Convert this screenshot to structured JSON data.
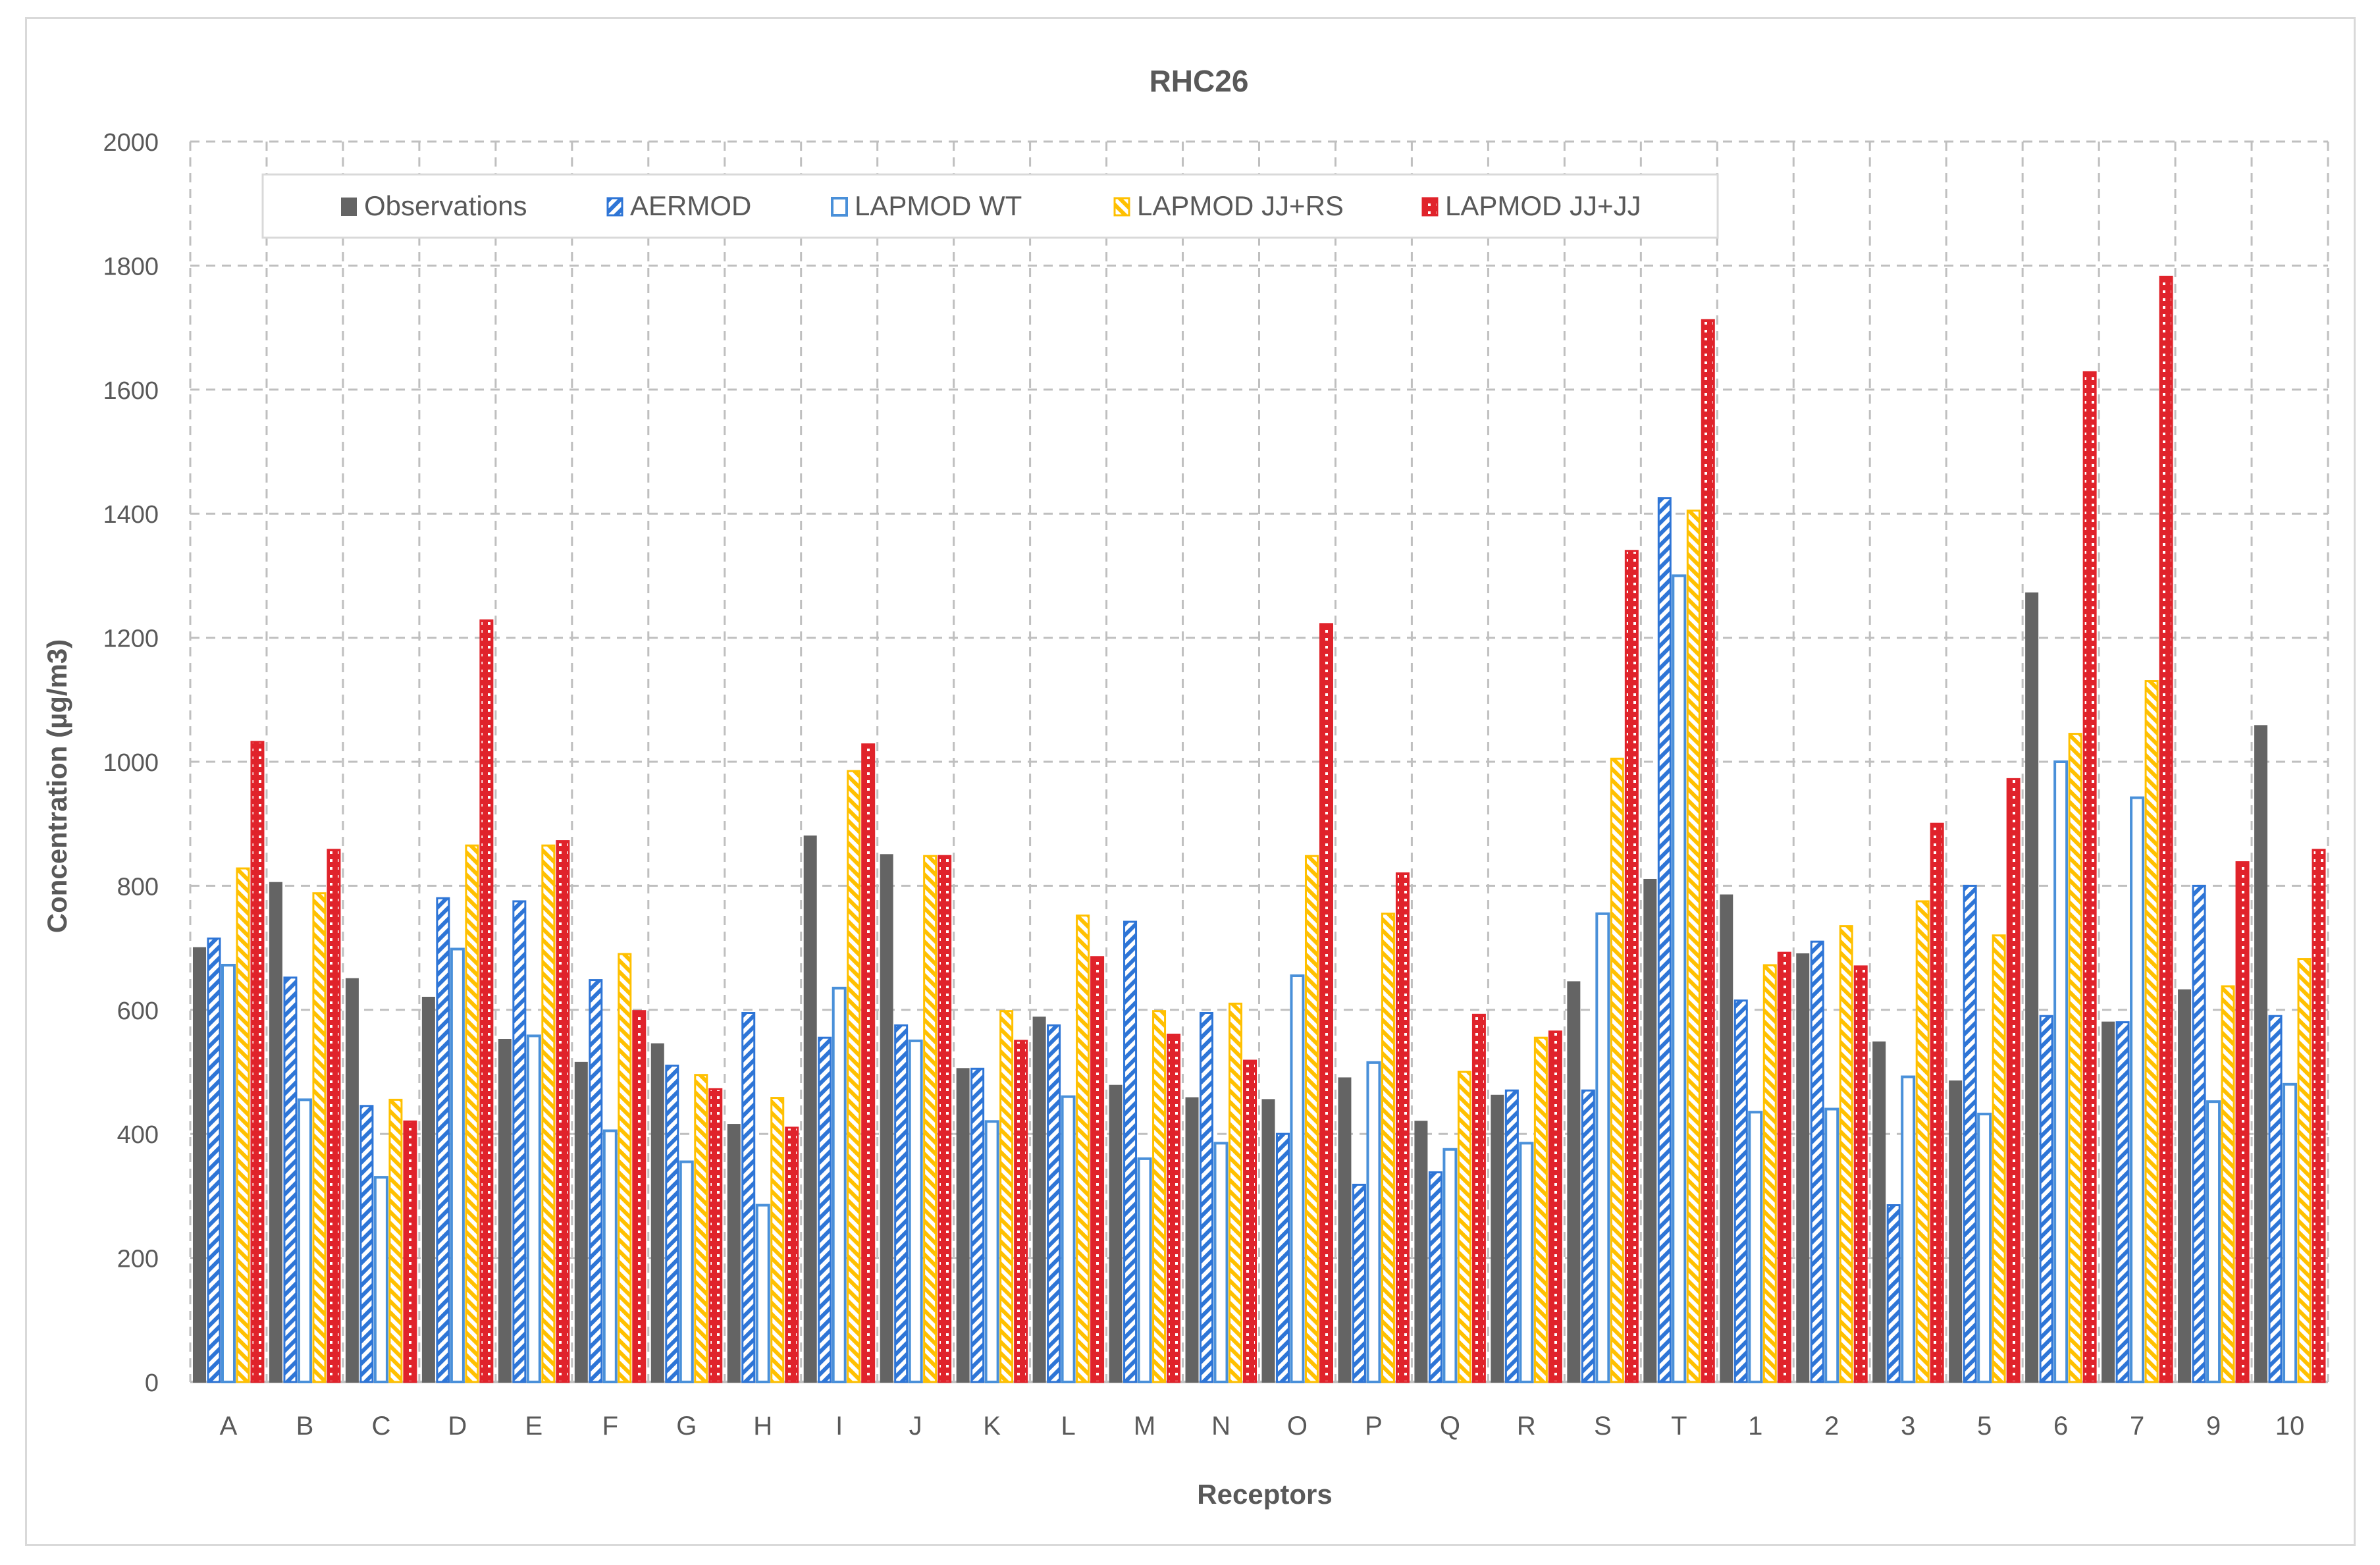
{
  "chart_data": {
    "type": "bar",
    "title": "RHC26",
    "xlabel": "Receptors",
    "ylabel": "Concentration (µg/m3)",
    "ylim": [
      0,
      2000
    ],
    "yticks": [
      0,
      200,
      400,
      600,
      800,
      1000,
      1200,
      1400,
      1600,
      1800,
      2000
    ],
    "grid": "dashed, both axes",
    "legend_position": "top-left, inside plot",
    "categories": [
      "A",
      "B",
      "C",
      "D",
      "E",
      "F",
      "G",
      "H",
      "I",
      "J",
      "K",
      "L",
      "M",
      "N",
      "O",
      "P",
      "Q",
      "R",
      "S",
      "T",
      "1",
      "2",
      "3",
      "5",
      "6",
      "7",
      "9",
      "10"
    ],
    "series": [
      {
        "name": "Observations",
        "color": "#646464",
        "pattern": "solid",
        "values": [
          700,
          805,
          650,
          620,
          552,
          515,
          545,
          415,
          880,
          850,
          505,
          588,
          478,
          458,
          455,
          490,
          420,
          462,
          645,
          810,
          785,
          690,
          548,
          485,
          1272,
          580,
          632,
          1058
        ]
      },
      {
        "name": "AERMOD",
        "color": "#2e75d6",
        "pattern": "diagonal-stripes",
        "values": [
          715,
          652,
          445,
          780,
          775,
          648,
          510,
          595,
          555,
          575,
          505,
          575,
          742,
          595,
          400,
          318,
          338,
          470,
          470,
          1425,
          615,
          710,
          285,
          800,
          590,
          580,
          800,
          590
        ]
      },
      {
        "name": "LAPMOD WT",
        "color": "#4a90d9",
        "pattern": "outline",
        "values": [
          672,
          455,
          330,
          698,
          558,
          405,
          355,
          285,
          635,
          550,
          420,
          460,
          360,
          385,
          655,
          515,
          375,
          385,
          755,
          1300,
          435,
          440,
          492,
          432,
          1000,
          942,
          452,
          480
        ]
      },
      {
        "name": "LAPMOD JJ+RS",
        "color": "#ffc000",
        "pattern": "diagonal-stripes",
        "values": [
          828,
          788,
          455,
          865,
          865,
          690,
          495,
          458,
          985,
          848,
          598,
          752,
          598,
          610,
          848,
          755,
          500,
          555,
          1005,
          1405,
          672,
          735,
          775,
          720,
          1045,
          1130,
          638,
          682
        ]
      },
      {
        "name": "LAPMOD JJ+JJ",
        "color": "#e0232b",
        "pattern": "dotted-red",
        "values": [
          1032,
          858,
          420,
          1228,
          872,
          598,
          472,
          410,
          1028,
          848,
          550,
          685,
          560,
          518,
          1222,
          820,
          592,
          565,
          1340,
          1712,
          692,
          670,
          900,
          972,
          1628,
          1782,
          838,
          858
        ]
      }
    ]
  }
}
